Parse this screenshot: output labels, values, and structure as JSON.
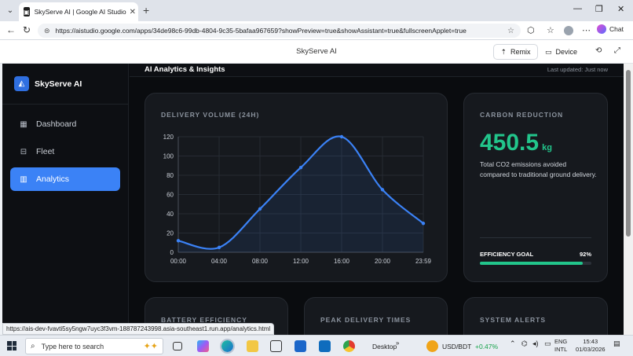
{
  "browser": {
    "tab_title": "SkyServe AI | Google AI Studio",
    "url": "https://aistudio.google.com/apps/34de98c6-99db-4804-9c35-5bafaa967659?showPreview=true&showAssistant=true&fullscreenApplet=true",
    "chat_label": "Chat",
    "status_url": "https://ais-dev-fvavti5sy5ngw7uyc3f3vm-188787243998.asia-southeast1.run.app/analytics.html"
  },
  "studio_header": {
    "title": "SkyServe AI",
    "remix_label": "Remix",
    "device_label": "Device"
  },
  "sidebar": {
    "brand": "SkyServe AI",
    "items": [
      {
        "label": "Dashboard",
        "icon": "grid-icon"
      },
      {
        "label": "Fleet",
        "icon": "box-icon"
      },
      {
        "label": "Analytics",
        "icon": "bar-chart-icon",
        "active": true
      }
    ]
  },
  "page": {
    "title": "AI Analytics & Insights",
    "last_updated": "Last updated: Just now"
  },
  "cards": {
    "delivery": {
      "label": "DELIVERY VOLUME (24H)"
    },
    "carbon": {
      "label": "CARBON REDUCTION",
      "value": "450.5",
      "unit": "kg",
      "description": "Total CO2 emissions avoided compared to traditional ground delivery.",
      "goal_label": "EFFICIENCY GOAL",
      "goal_percent_text": "92%",
      "goal_fraction": 0.92
    },
    "battery": {
      "label": "BATTERY EFFICIENCY"
    },
    "peak": {
      "label": "PEAK DELIVERY TIMES"
    },
    "alerts": {
      "label": "SYSTEM ALERTS"
    }
  },
  "chart_data": {
    "type": "area",
    "title": "DELIVERY VOLUME (24H)",
    "categories": [
      "00:00",
      "04:00",
      "08:00",
      "12:00",
      "16:00",
      "20:00",
      "23:59"
    ],
    "values": [
      12,
      5,
      45,
      88,
      120,
      65,
      30
    ],
    "y_ticks": [
      0,
      20,
      40,
      60,
      80,
      100,
      120
    ],
    "ylim": [
      0,
      120
    ],
    "grid": true,
    "color": "#3b82f6"
  },
  "taskbar": {
    "search_placeholder": "Type here to search",
    "desktop_label": "Desktop",
    "currency_label": "USD/BDT",
    "currency_change": "+0.47%",
    "lang_top": "ENG",
    "lang_bottom": "INTL",
    "time": "15:43",
    "date": "01/03/2026"
  }
}
